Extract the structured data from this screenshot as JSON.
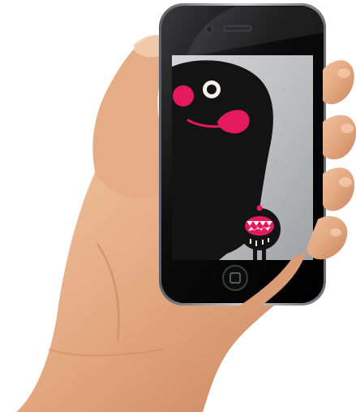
{
  "scene": {
    "subject": "hand-holding-phone",
    "colors": {
      "skin": "#e2a77f",
      "skin_shadow": "#c7835a",
      "skin_highlight": "#f2c6a2",
      "phone_body": "#0b0b0c",
      "phone_bezel": "#1b1b1d",
      "phone_rim": "#9a9ea3",
      "wallpaper_bg": "#b9bbbd",
      "monster_black": "#121212",
      "monster_pink": "#e5195d",
      "eye_white": "#f4f1e6"
    },
    "icons": {
      "home_button": "home-button-icon",
      "camera": "front-camera-icon",
      "speaker": "earpiece-speaker-icon"
    }
  }
}
